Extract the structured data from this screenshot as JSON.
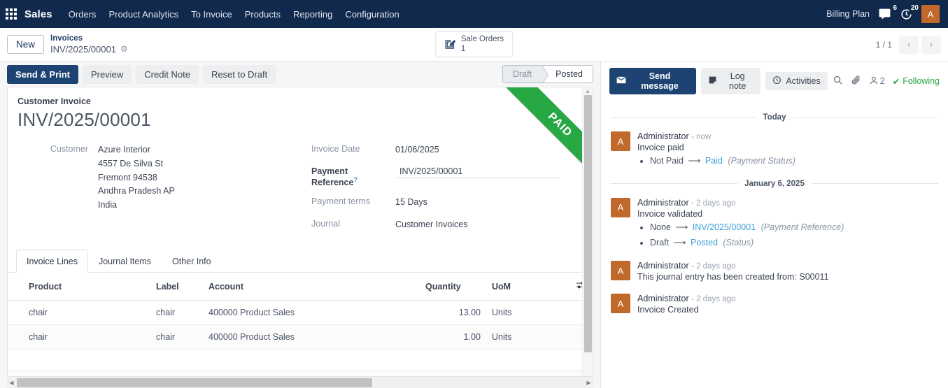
{
  "navbar": {
    "apps_icon": "apps-grid-icon",
    "brand": "Sales",
    "menu": [
      "Orders",
      "Product Analytics",
      "To Invoice",
      "Products",
      "Reporting",
      "Configuration"
    ],
    "billing_plan": "Billing Plan",
    "messages_badge": "6",
    "activities_badge": "20",
    "avatar_initial": "A"
  },
  "control_panel": {
    "new_label": "New",
    "breadcrumb_parent": "Invoices",
    "breadcrumb_current": "INV/2025/00001",
    "gear_icon": "gear-icon",
    "stat_button": {
      "label": "Sale Orders",
      "value": "1",
      "icon": "pencil-square-icon"
    },
    "pager": {
      "count": "1 / 1",
      "prev": "‹",
      "next": "›"
    }
  },
  "form": {
    "buttons": [
      {
        "label": "Send & Print",
        "style": "primary"
      },
      {
        "label": "Preview",
        "style": "secondary"
      },
      {
        "label": "Credit Note",
        "style": "secondary"
      },
      {
        "label": "Reset to Draft",
        "style": "secondary"
      }
    ],
    "statusbar": {
      "stages": [
        "Draft",
        "Posted"
      ],
      "active": "Posted"
    },
    "ribbon": "PAID",
    "ribbon_color": "#28a745",
    "subtitle": "Customer Invoice",
    "title": "INV/2025/00001",
    "customer": {
      "label": "Customer",
      "name": "Azure Interior",
      "street": "4557 De Silva St",
      "city": "Fremont 94538",
      "state": "Andhra Pradesh AP",
      "country": "India"
    },
    "right_fields": [
      {
        "label": "Invoice Date",
        "value": "01/06/2025",
        "bold": false,
        "help": false,
        "input": false
      },
      {
        "label": "Payment Reference",
        "value": "INV/2025/00001",
        "bold": true,
        "help": true,
        "input": true
      },
      {
        "label": "Payment terms",
        "value": "15 Days",
        "bold": false,
        "help": false,
        "input": false
      },
      {
        "label": "Journal",
        "value": "Customer Invoices",
        "bold": false,
        "help": false,
        "input": false
      }
    ],
    "tabs": [
      "Invoice Lines",
      "Journal Items",
      "Other Info"
    ],
    "active_tab": "Invoice Lines",
    "table": {
      "headers": [
        "Product",
        "Label",
        "Account",
        "Quantity",
        "UoM"
      ],
      "optional_columns_icon": "sliders-icon",
      "rows": [
        {
          "product": "chair",
          "label": "chair",
          "account": "400000 Product Sales",
          "quantity": "13.00",
          "uom": "Units"
        },
        {
          "product": "chair",
          "label": "chair",
          "account": "400000 Product Sales",
          "quantity": "1.00",
          "uom": "Units"
        }
      ]
    }
  },
  "chatter": {
    "send_message": "Send message",
    "log_note": "Log note",
    "activities": "Activities",
    "search_icon": "search-icon",
    "attachment_icon": "paperclip-icon",
    "follower_icon": "user-icon",
    "follower_count": "2",
    "following": "Following",
    "groups": [
      {
        "date": "Today",
        "messages": [
          {
            "avatar": "A",
            "author": "Administrator",
            "time": "- now",
            "text": "Invoice paid",
            "tracking": [
              {
                "old": "Not Paid",
                "arrow": "⟶",
                "new": "Paid",
                "field": "(Payment Status)"
              }
            ]
          }
        ]
      },
      {
        "date": "January 6, 2025",
        "messages": [
          {
            "avatar": "A",
            "author": "Administrator",
            "time": "- 2 days ago",
            "text": "Invoice validated",
            "tracking": [
              {
                "old": "None",
                "arrow": "⟶",
                "new": "INV/2025/00001",
                "field": "(Payment Reference)"
              },
              {
                "old": "Draft",
                "arrow": "⟶",
                "new": "Posted",
                "field": "(Status)"
              }
            ]
          },
          {
            "avatar": "A",
            "author": "Administrator",
            "time": "- 2 days ago",
            "text": "This journal entry has been created from: S00011",
            "tracking": []
          },
          {
            "avatar": "A",
            "author": "Administrator",
            "time": "- 2 days ago",
            "text": "Invoice Created",
            "tracking": []
          }
        ]
      }
    ]
  },
  "colors": {
    "navbar": "#11294d",
    "primary": "#1d4372",
    "paid_green": "#28a745",
    "avatar": "#c0692a",
    "link": "#3aa0d8"
  }
}
